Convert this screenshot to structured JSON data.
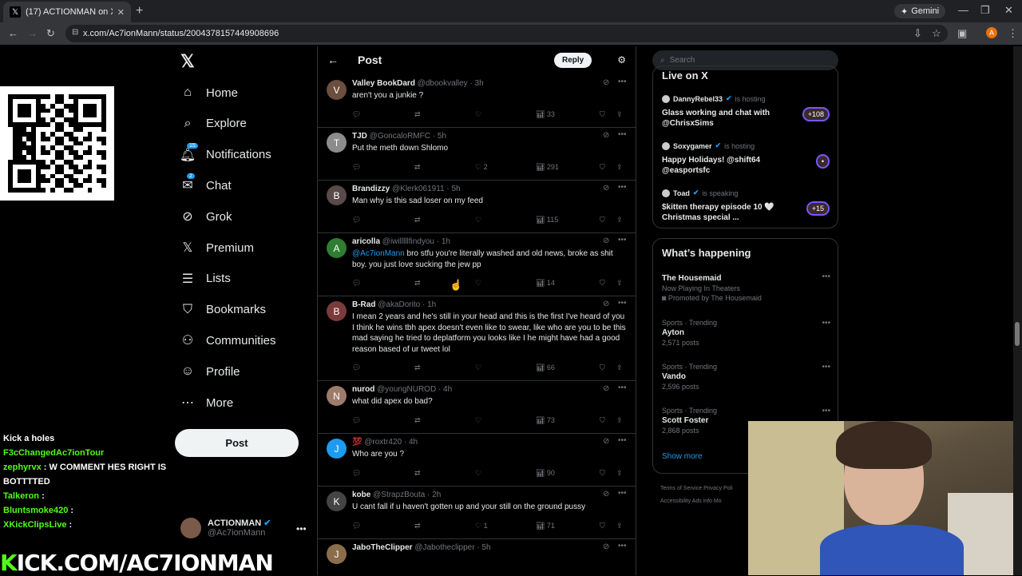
{
  "browser": {
    "tab_title": "(17) ACTIONMAN on X: \"Haha",
    "url": "x.com/Ac7ionMann/status/2004378157449908696",
    "gemini_label": "Gemini",
    "profile_letter": "A"
  },
  "nav": {
    "items": [
      {
        "label": "Home",
        "icon": "home-icon"
      },
      {
        "label": "Explore",
        "icon": "search-icon"
      },
      {
        "label": "Notifications",
        "icon": "bell-icon",
        "badge": "15"
      },
      {
        "label": "Chat",
        "icon": "mail-icon",
        "badge": "2"
      },
      {
        "label": "Grok",
        "icon": "grok-icon"
      },
      {
        "label": "Premium",
        "icon": "x-icon"
      },
      {
        "label": "Lists",
        "icon": "list-icon"
      },
      {
        "label": "Bookmarks",
        "icon": "bookmark-icon"
      },
      {
        "label": "Communities",
        "icon": "people-icon"
      },
      {
        "label": "Profile",
        "icon": "person-icon"
      },
      {
        "label": "More",
        "icon": "more-circle-icon"
      }
    ],
    "post_label": "Post",
    "me_name": "ACTIONMAN",
    "me_handle": "@Ac7ionMann"
  },
  "header": {
    "title": "Post",
    "reply_label": "Reply"
  },
  "tweets": [
    {
      "name": "Valley BookDard",
      "handle": "@dbookvalley",
      "time": "3h",
      "text": "aren't you a junkie ?",
      "likes": "",
      "views": "33",
      "avatar": "V"
    },
    {
      "name": "TJD",
      "handle": "@GoncaloRMFC",
      "time": "5h",
      "text": "Put the meth down Shlomo",
      "likes": "2",
      "views": "291",
      "avatar": "T"
    },
    {
      "name": "Brandizzy",
      "handle": "@Klerk061911",
      "time": "5h",
      "text": "Man why is this sad loser on my feed",
      "likes": "",
      "views": "115",
      "avatar": "B"
    },
    {
      "name": "aricolla",
      "handle": "@iwilllllfindyou",
      "time": "1h",
      "mention": "@Ac7ionMann",
      "text": " bro stfu you're literally washed and old news, broke as shit boy. you just love sucking the jew pp",
      "likes": "",
      "views": "14",
      "avatar": "A"
    },
    {
      "name": "B-Rad",
      "handle": "@akaDorito",
      "time": "1h",
      "text": "I mean 2 years and he's still in your head and this is the first I've heard of you I think he wins tbh apex doesn't even like to swear, like who are you to be this mad saying he tried to deplatform you looks like I he might have had a good reason based of ur tweet lol",
      "likes": "",
      "views": "66",
      "avatar": "B"
    },
    {
      "name": "nurod",
      "handle": "@youngNUROD",
      "time": "4h",
      "text": "what did apex do bad?",
      "likes": "",
      "views": "73",
      "avatar": "N"
    },
    {
      "name": "💯",
      "handle": "@roxtr420",
      "time": "4h",
      "text": "Who are you ?",
      "likes": "",
      "views": "90",
      "avatar": "J"
    },
    {
      "name": "kobe",
      "handle": "@StrapzBouta",
      "time": "2h",
      "text": "U cant fall if u haven't gotten up and your still on the ground pussy",
      "likes": "1",
      "views": "71",
      "avatar": "K"
    },
    {
      "name": "JaboTheClipper",
      "handle": "@Jabotheclipper",
      "time": "5h",
      "text": "",
      "likes": "",
      "views": "",
      "avatar": "J"
    }
  ],
  "search": {
    "placeholder": "Search"
  },
  "live": {
    "title": "Live on X",
    "items": [
      {
        "host": "DannyRebel33",
        "status": "is hosting",
        "text": "Glass working and chat with @ChrisxSims",
        "count": "+108"
      },
      {
        "host": "Soxygamer",
        "status": "is hosting",
        "text": "Happy Holidays! @shift64 @easportsfc",
        "count": ""
      },
      {
        "host": "Toad",
        "status": "is speaking",
        "text": "$kitten therapy episode 10 🤍Christmas special ...",
        "count": "+15"
      }
    ]
  },
  "trends": {
    "title": "What’s happening",
    "items": [
      {
        "category": "",
        "name": "The Housemaid",
        "sub": "Now Playing In Theaters",
        "promo": "Promoted by The Housemaid"
      },
      {
        "category": "Sports · Trending",
        "name": "Ayton",
        "sub": "2,571 posts",
        "promo": ""
      },
      {
        "category": "Sports · Trending",
        "name": "Vando",
        "sub": "2,596 posts",
        "promo": ""
      },
      {
        "category": "Sports · Trending",
        "name": "Scott Foster",
        "sub": "2,868 posts",
        "promo": ""
      }
    ],
    "show_more": "Show more"
  },
  "footer": {
    "links": "Terms of Service   Privacy Poli   Accessibility   Ads info   Mo"
  },
  "stream_chat": [
    {
      "user": "",
      "text": "Kick a holes"
    },
    {
      "user": "F3cChangedAc7ionTour",
      "text": ""
    },
    {
      "user": "zephyrvx",
      "text": ": W COMMENT HES RIGHT IS BOTTTTED"
    },
    {
      "user": "Talkeron",
      "text": ":"
    },
    {
      "user": "Bluntsmoke420",
      "text": ":"
    },
    {
      "user": "XKickClipsLive",
      "text": ":"
    }
  ],
  "kick_banner": {
    "k": "K",
    "rest": "ICK.COM/AC7IONMAN"
  }
}
